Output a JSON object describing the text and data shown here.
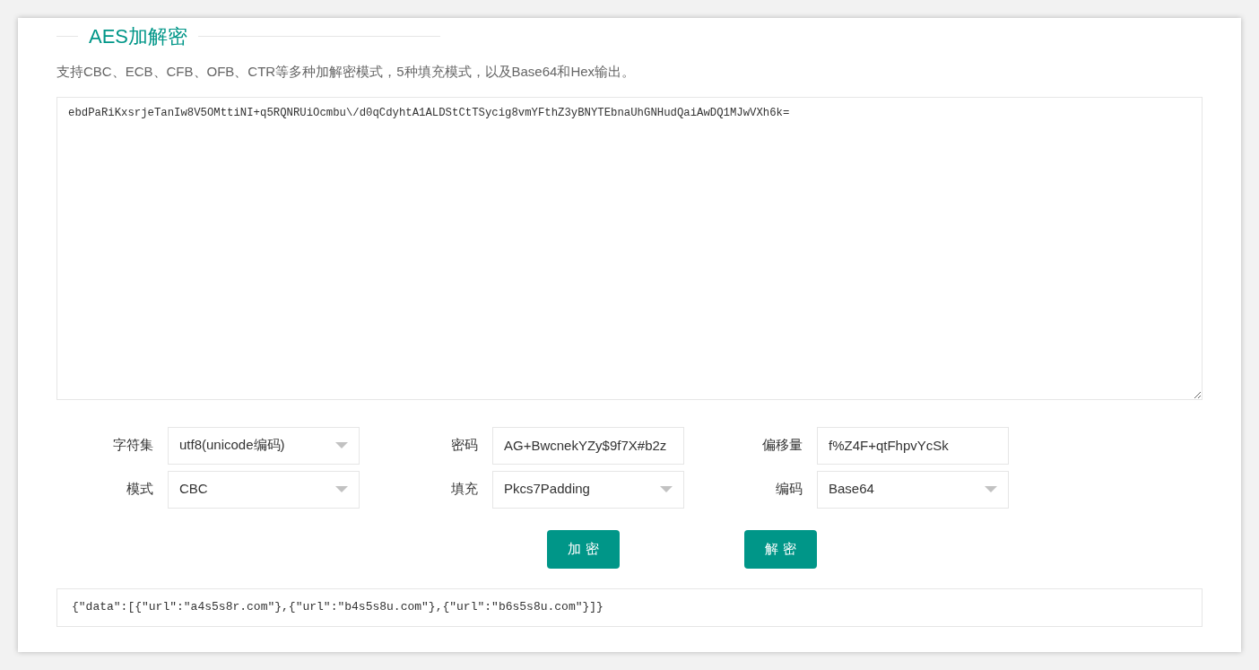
{
  "title": "AES加解密",
  "description": "支持CBC、ECB、CFB、OFB、CTR等多种加解密模式，5种填充模式，以及Base64和Hex输出。",
  "input_text": "ebdPaRiKxsrjeTanIw8V5OMttiNI+q5RQNRUiOcmbu\\/d0qCdyhtA1ALDStCtTSycig8vmYFthZ3yBNYTEbnaUhGNHudQaiAwDQ1MJwVXh6k=",
  "form_rows": [
    [
      {
        "label": "字符集",
        "kind": "select",
        "value": "utf8(unicode编码)"
      },
      {
        "label": "密码",
        "kind": "input",
        "value": "AG+BwcnekYZy$9f7X#b2z"
      },
      {
        "label": "偏移量",
        "kind": "input",
        "value": "f%Z4F+qtFhpvYcSk"
      }
    ],
    [
      {
        "label": "模式",
        "kind": "select",
        "value": "CBC"
      },
      {
        "label": "填充",
        "kind": "select",
        "value": "Pkcs7Padding"
      },
      {
        "label": "编码",
        "kind": "select",
        "value": "Base64"
      }
    ]
  ],
  "buttons": [
    "加 密",
    "解 密"
  ],
  "output_text": "{\"data\":[{\"url\":\"a4s5s8r.com\"},{\"url\":\"b4s5s8u.com\"},{\"url\":\"b6s5s8u.com\"}]}"
}
